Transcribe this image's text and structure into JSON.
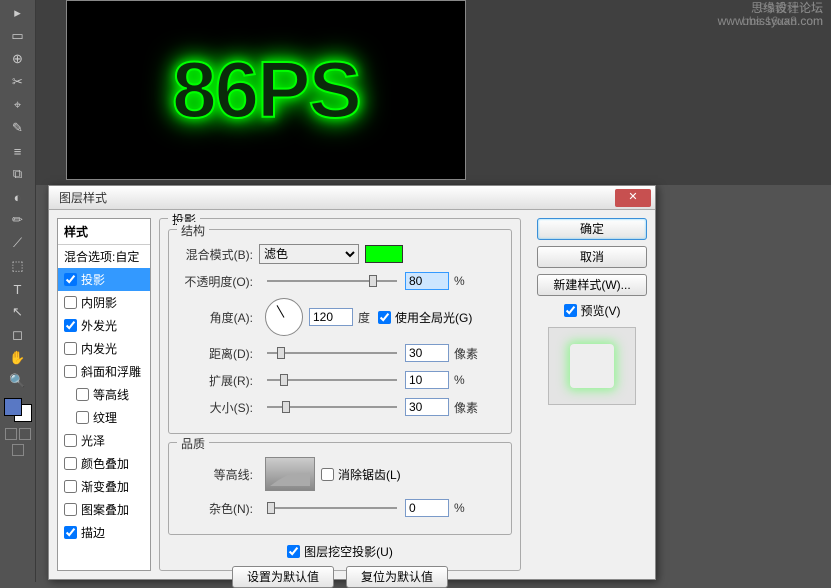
{
  "watermark": {
    "line1": "思缘设计论坛",
    "line2": "PS教程论坛",
    "line3": "www.missyuan.com",
    "line4": "bbs.16xx8.com"
  },
  "canvas": {
    "text": "86PS"
  },
  "dialog": {
    "title": "图层样式"
  },
  "styles": {
    "header": "样式",
    "blending": "混合选项:自定",
    "dropShadow": "投影",
    "innerShadow": "内阴影",
    "outerGlow": "外发光",
    "innerGlow": "内发光",
    "bevel": "斜面和浮雕",
    "contour": "等高线",
    "texture": "纹理",
    "satin": "光泽",
    "colorOverlay": "颜色叠加",
    "gradientOverlay": "渐变叠加",
    "patternOverlay": "图案叠加",
    "stroke": "描边"
  },
  "panel": {
    "title": "投影",
    "structure": "结构",
    "blendMode": "混合模式(B):",
    "blendModeValue": "滤色",
    "opacity": "不透明度(O):",
    "opacityValue": "80",
    "opacityUnit": "%",
    "angle": "角度(A):",
    "angleValue": "120",
    "angleUnit": "度",
    "useGlobal": "使用全局光(G)",
    "distance": "距离(D):",
    "distanceValue": "30",
    "distanceUnit": "像素",
    "spread": "扩展(R):",
    "spreadValue": "10",
    "spreadUnit": "%",
    "size": "大小(S):",
    "sizeValue": "30",
    "sizeUnit": "像素",
    "quality": "品质",
    "contourLabel": "等高线:",
    "antiAlias": "消除锯齿(L)",
    "noise": "杂色(N):",
    "noiseValue": "0",
    "noiseUnit": "%",
    "knockout": "图层挖空投影(U)",
    "setDefault": "设置为默认值",
    "resetDefault": "复位为默认值"
  },
  "buttons": {
    "ok": "确定",
    "cancel": "取消",
    "newStyle": "新建样式(W)...",
    "preview": "预览(V)"
  },
  "tools": [
    "▸",
    "▭",
    "⊕",
    "✂",
    "⌖",
    "✎",
    "≡",
    "⧉",
    "◐",
    "✏",
    "⟋",
    "⬚",
    "T",
    "↖",
    "◻",
    "✋",
    "🔍"
  ]
}
